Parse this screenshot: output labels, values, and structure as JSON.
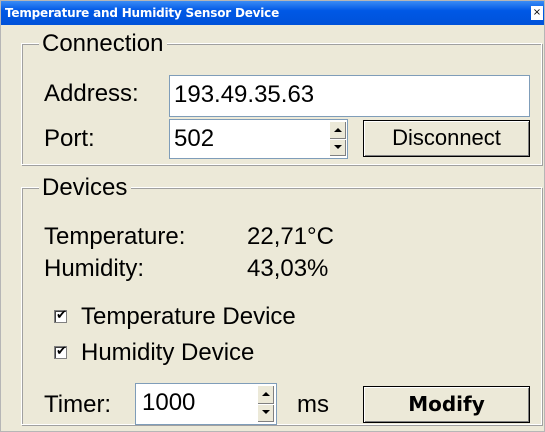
{
  "window": {
    "title": "Temperature and Humidity Sensor Device",
    "close_glyph": "×"
  },
  "connection": {
    "legend": "Connection",
    "address_label": "Address:",
    "address_value": "193.49.35.63",
    "port_label": "Port:",
    "port_value": "502",
    "disconnect_label": "Disconnect"
  },
  "devices": {
    "legend": "Devices",
    "temperature_label": "Temperature:",
    "temperature_value": "22,71°C",
    "humidity_label": "Humidity:",
    "humidity_value": "43,03%",
    "temperature_device_label": "Temperature Device",
    "temperature_device_checked": true,
    "humidity_device_label": "Humidity Device",
    "humidity_device_checked": true,
    "check_glyph": "✔",
    "timer_label": "Timer:",
    "timer_value": "1000",
    "timer_unit": "ms",
    "modify_label": "Modify"
  },
  "icons": [
    "close-icon",
    "spin-up-icon",
    "spin-down-icon",
    "checkmark-icon"
  ],
  "colors": {
    "titlebar": "#0054e3",
    "window_bg": "#ece9d8",
    "field_border": "#7f9db9"
  }
}
